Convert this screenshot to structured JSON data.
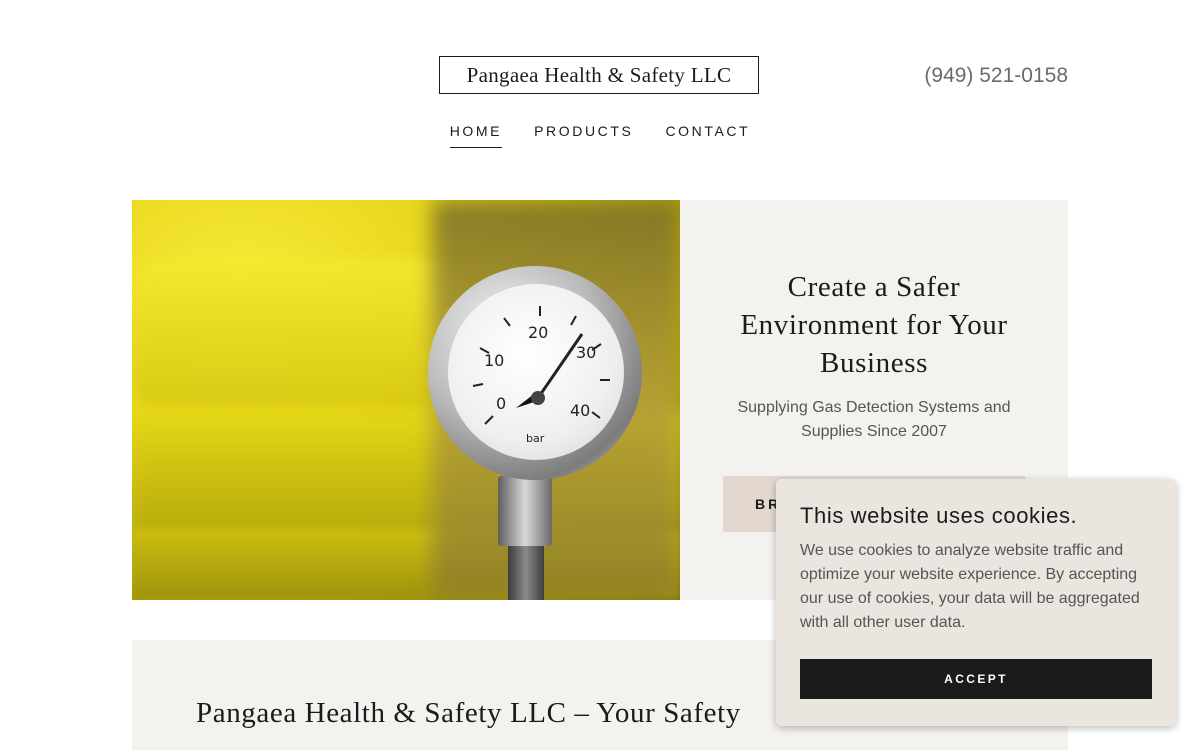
{
  "header": {
    "logo": "Pangaea Health & Safety LLC",
    "phone": "(949) 521-0158"
  },
  "nav": {
    "items": [
      {
        "label": "HOME",
        "active": true
      },
      {
        "label": "PRODUCTS",
        "active": false
      },
      {
        "label": "CONTACT",
        "active": false
      }
    ]
  },
  "hero": {
    "image_alt": "Pressure gauge on yellow gas pipe",
    "gauge_labels": [
      "0",
      "10",
      "20",
      "30",
      "40",
      "bar"
    ],
    "title": "Create a Safer Environment for Your Business",
    "subtitle": "Supplying Gas Detection Systems and Supplies Since 2007",
    "button_label": "BROWSE PRODUCTS"
  },
  "section2": {
    "title": "Pangaea Health & Safety LLC – Your Safety"
  },
  "cookie_banner": {
    "title": "This website uses cookies.",
    "text": "We use cookies to analyze website traffic and optimize your website experience. By accepting our use of cookies, your data will be aggregated with all other user data.",
    "accept_label": "ACCEPT"
  },
  "colors": {
    "accent": "#1b1b1b",
    "panel_bg": "#f4f2ef",
    "button_bg": "#e2d8d0",
    "phone_text": "#6f6a66",
    "cookie_bg": "#ebe5df"
  }
}
